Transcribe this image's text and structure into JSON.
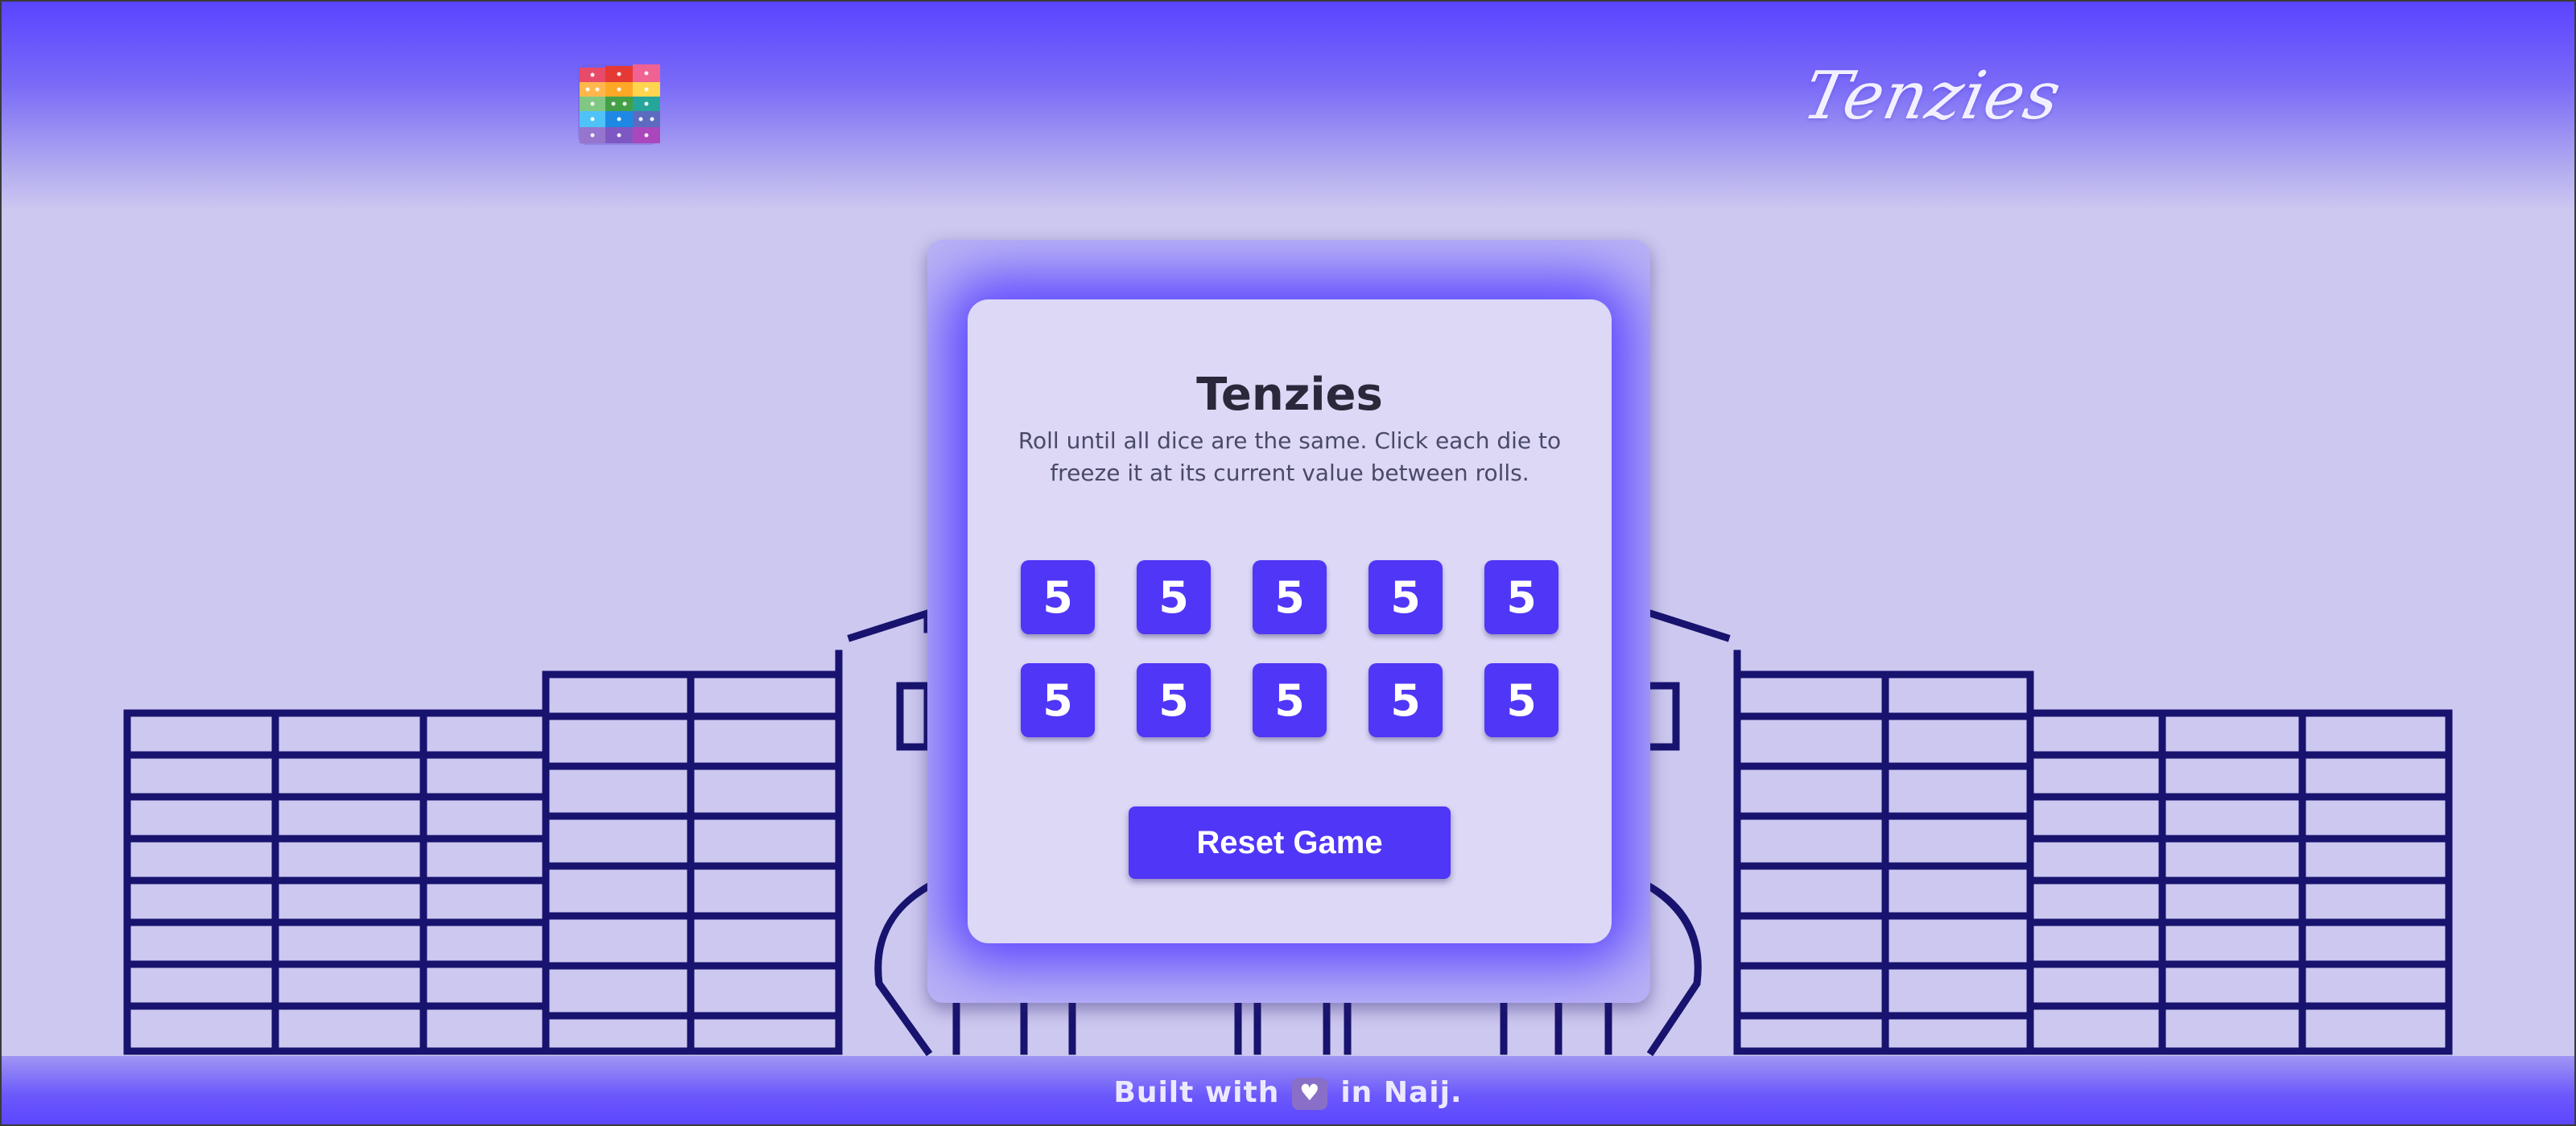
{
  "brand": {
    "logo_icon": "dice-stack-logo",
    "title": "Tenzies"
  },
  "game": {
    "title": "Tenzies",
    "instructions": "Roll until all dice are the same. Click each die to freeze it at its current value between rolls.",
    "dice": [
      "5",
      "5",
      "5",
      "5",
      "5",
      "5",
      "5",
      "5",
      "5",
      "5"
    ],
    "reset_label": "Reset Game"
  },
  "footer": {
    "prefix": "Built with",
    "heart_icon": "heart-icon",
    "suffix": "in Naij."
  },
  "colors": {
    "accent": "#5036f6",
    "header": "#5a44ff",
    "background": "#cdc8f0",
    "card": "#dcd8f6"
  }
}
